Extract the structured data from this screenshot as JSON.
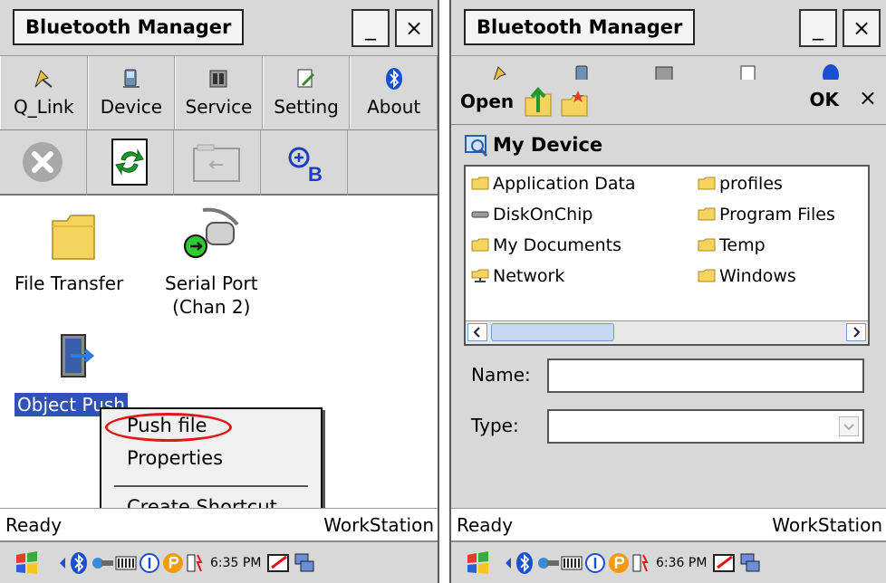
{
  "left": {
    "window": {
      "title": "Bluetooth Manager",
      "minimize_glyph": "_",
      "close_glyph": "×"
    },
    "menu": [
      {
        "label": "Q_Link",
        "icon": "q-link-icon"
      },
      {
        "label": "Device",
        "icon": "device-icon"
      },
      {
        "label": "Service",
        "icon": "service-icon"
      },
      {
        "label": "Setting",
        "icon": "setting-icon"
      },
      {
        "label": "About",
        "icon": "bluetooth-icon"
      }
    ],
    "actions": [
      {
        "icon": "disconnect-icon"
      },
      {
        "icon": "refresh-icon"
      },
      {
        "icon": "folder-icon"
      },
      {
        "icon": "bluetooth-b-icon",
        "glyph_letter": "B"
      }
    ],
    "services": [
      {
        "label": "File Transfer",
        "icon": "folder-icon"
      },
      {
        "label": "Serial Port\n(Chan 2)",
        "icon": "serial-port-icon"
      },
      {
        "label": "Object Push",
        "icon": "object-push-icon",
        "selected": true
      }
    ],
    "context_menu": {
      "items": [
        "Push file",
        "Properties",
        "Create Shortcut"
      ],
      "highlighted": "Push file",
      "highlight_color": "#e01818"
    },
    "status": {
      "left": "Ready",
      "right": "WorkStation"
    },
    "taskbar": {
      "time": "6:35 PM"
    }
  },
  "right": {
    "window": {
      "title": "Bluetooth Manager",
      "minimize_glyph": "_",
      "close_glyph": "×"
    },
    "dialog": {
      "title": "Open",
      "ok_label": "OK",
      "close_glyph": "×",
      "location": "My Device",
      "files_col1": [
        "Application Data",
        "DiskOnChip",
        "My Documents",
        "Network"
      ],
      "files_col2": [
        "profiles",
        "Program Files",
        "Temp",
        "Windows"
      ],
      "name_label": "Name:",
      "type_label": "Type:",
      "name_value": "",
      "type_value": ""
    },
    "status": {
      "left": "Ready",
      "right": "WorkStation"
    },
    "taskbar": {
      "time": "6:36 PM"
    }
  },
  "colors": {
    "chrome": "#d8d8d8",
    "selection": "#2f52b4",
    "folder_yellow": "#f4d35e",
    "bluetooth_blue": "#1a4fd0"
  }
}
